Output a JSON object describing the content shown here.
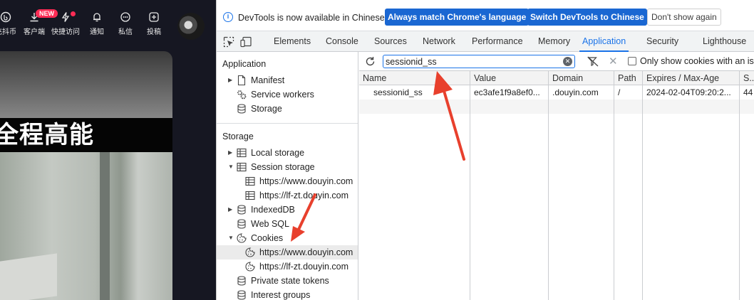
{
  "webpage": {
    "topbar": [
      {
        "label": "充抖币",
        "icon": "coin-icon"
      },
      {
        "label": "客户端",
        "icon": "download-icon"
      },
      {
        "label": "快捷访问",
        "icon": "lightning-icon"
      },
      {
        "label": "通知",
        "icon": "bell-icon"
      },
      {
        "label": "私信",
        "icon": "chat-icon"
      },
      {
        "label": "投稿",
        "icon": "plus-icon"
      }
    ],
    "new_badge": "NEW",
    "video_caption": "全程高能"
  },
  "infobar": {
    "icon": "info-icon",
    "text": "DevTools is now available in Chinese!",
    "buttons": [
      "Always match Chrome's language",
      "Switch DevTools to Chinese",
      "Don't show again"
    ]
  },
  "tabs": [
    "Elements",
    "Console",
    "Sources",
    "Network",
    "Performance",
    "Memory",
    "Application",
    "Security",
    "Lighthouse"
  ],
  "active_tab": "Application",
  "sidebar": {
    "application_title": "Application",
    "application_items": [
      "Manifest",
      "Service workers",
      "Storage"
    ],
    "storage_title": "Storage",
    "storage_items": [
      {
        "label": "Local storage"
      },
      {
        "label": "Session storage"
      },
      {
        "label": "https://www.douyin.com"
      },
      {
        "label": "https://lf-zt.douyin.com"
      },
      {
        "label": "IndexedDB"
      },
      {
        "label": "Web SQL"
      },
      {
        "label": "Cookies"
      },
      {
        "label": "https://www.douyin.com"
      },
      {
        "label": "https://lf-zt.douyin.com"
      },
      {
        "label": "Private state tokens"
      },
      {
        "label": "Interest groups"
      }
    ]
  },
  "cookies": {
    "filter_value": "sessionid_ss",
    "only_show_label": "Only show cookies with an iss",
    "columns": [
      "Name",
      "Value",
      "Domain",
      "Path",
      "Expires / Max-Age",
      "S..."
    ],
    "rows": [
      [
        "sessionid_ss",
        "ec3afe1f9a8ef0...",
        ".douyin.com",
        "/",
        "2024-02-04T09:20:2...",
        "44"
      ]
    ]
  },
  "colors": {
    "accent": "#1a73e8",
    "primary_button": "#1a67d2",
    "annotation_arrow": "#e8402d"
  }
}
